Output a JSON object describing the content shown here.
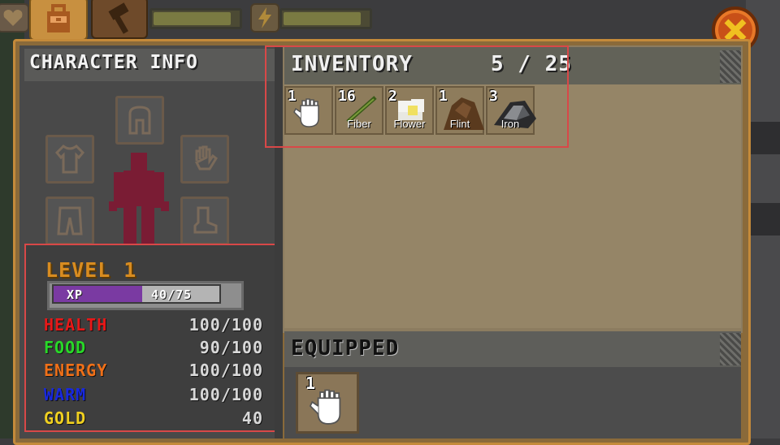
{
  "top_bar": {
    "icons": [
      "heart-icon",
      "backpack-icon",
      "hammer-icon",
      "lightning-icon",
      "close-icon"
    ],
    "health_bar_fraction": 0.88,
    "energy_bar_fraction": 0.88
  },
  "character": {
    "title": "CHARACTER INFO",
    "slots": [
      "helmet-slot-icon",
      "shirt-slot-icon",
      "glove-slot-icon",
      "pants-slot-icon",
      "boot-slot-icon"
    ],
    "level_label": "LEVEL 1",
    "xp": {
      "label": "XP",
      "value": "40/75",
      "fraction": 0.533
    },
    "stats": [
      {
        "label": "HEALTH",
        "value": "100/100",
        "color": "#e81818"
      },
      {
        "label": "FOOD",
        "value": "90/100",
        "color": "#28d828"
      },
      {
        "label": "ENERGY",
        "value": "100/100",
        "color": "#f07018"
      },
      {
        "label": "WARM",
        "value": "100/100",
        "color": "#1828e0"
      },
      {
        "label": "GOLD",
        "value": "40",
        "color": "#f0d020"
      }
    ]
  },
  "inventory": {
    "title": "INVENTORY",
    "count": "5 / 25",
    "items": [
      {
        "count": "1",
        "name": "",
        "icon": "fist-icon"
      },
      {
        "count": "16",
        "name": "Fiber",
        "icon": "fiber-icon"
      },
      {
        "count": "2",
        "name": "Flower",
        "icon": "flower-icon"
      },
      {
        "count": "1",
        "name": "Flint",
        "icon": "flint-icon"
      },
      {
        "count": "3",
        "name": "Iron",
        "icon": "iron-icon"
      }
    ]
  },
  "equipped": {
    "title": "EQUIPPED",
    "item": {
      "count": "1",
      "icon": "fist-icon"
    }
  }
}
